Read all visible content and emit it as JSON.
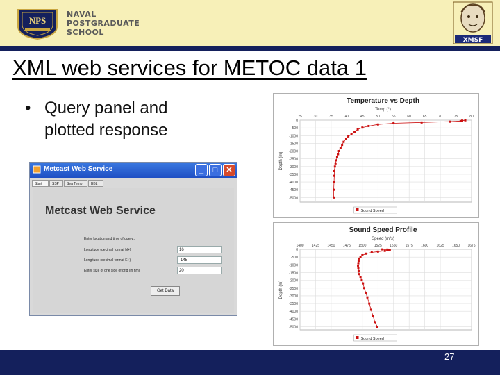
{
  "header": {
    "logo_text": "NPS",
    "school_lines": [
      "NAVAL",
      "POSTGRADUATE",
      "SCHOOL"
    ],
    "xmsf_logo_text": "XMSF"
  },
  "title": "XML web services for METOC data 1",
  "bullet": "Query panel and plotted response",
  "app": {
    "window_title": "Metcast Web Service",
    "tabs": [
      "Start",
      "SSP",
      "Sea Temp",
      "BBL"
    ],
    "heading": "Metcast Web Service",
    "form_intro": "Enter location and time of query...",
    "fields": [
      {
        "label": "Longitude (decimal format N+)",
        "value": "16"
      },
      {
        "label": "Longitude (decimal format E+)",
        "value": "-145"
      },
      {
        "label": "Enter size of one side of grid (in nm)",
        "value": "20"
      }
    ],
    "button": "Get Data"
  },
  "chart_data": [
    {
      "type": "line",
      "title": "Temperature vs Depth",
      "xlabel": "Temp (°)",
      "ylabel": "Depth (m)",
      "x_ticks": [
        "25",
        "30",
        "35",
        "40",
        "45",
        "50",
        "55",
        "60",
        "65",
        "70",
        "75",
        "80"
      ],
      "y_ticks": [
        "0",
        "-500",
        "-1000",
        "-1500",
        "-2000",
        "-2500",
        "-3000",
        "-3500",
        "-4000",
        "-4500",
        "-5000"
      ],
      "xlim": [
        25,
        80
      ],
      "ylim": [
        -5300,
        0
      ],
      "grid": true,
      "legend": "bottom",
      "series": [
        {
          "name": "Sound Speed",
          "color": "#cc1111",
          "points": [
            [
              78,
              -10
            ],
            [
              77,
              -30
            ],
            [
              76.5,
              -60
            ],
            [
              73,
              -100
            ],
            [
              64,
              -150
            ],
            [
              55,
              -200
            ],
            [
              50,
              -280
            ],
            [
              47,
              -380
            ],
            [
              45,
              -480
            ],
            [
              43.5,
              -600
            ],
            [
              42.5,
              -750
            ],
            [
              41.5,
              -900
            ],
            [
              40.5,
              -1050
            ],
            [
              39.8,
              -1200
            ],
            [
              39,
              -1400
            ],
            [
              38.5,
              -1600
            ],
            [
              38,
              -1800
            ],
            [
              37.5,
              -2000
            ],
            [
              37.2,
              -2200
            ],
            [
              36.9,
              -2400
            ],
            [
              36.6,
              -2600
            ],
            [
              36.4,
              -2800
            ],
            [
              36.2,
              -3000
            ],
            [
              36,
              -3300
            ],
            [
              36,
              -3600
            ],
            [
              35.9,
              -4000
            ],
            [
              35.8,
              -4500
            ],
            [
              35.8,
              -5000
            ]
          ]
        }
      ]
    },
    {
      "type": "line",
      "title": "Sound Speed Profile",
      "xlabel": "Speed (m/s)",
      "ylabel": "Depth (m)",
      "x_ticks": [
        "1400",
        "1425",
        "1450",
        "1475",
        "1500",
        "1525",
        "1550",
        "1575",
        "1600",
        "1625",
        "1650",
        "1675"
      ],
      "y_ticks": [
        "0",
        "-500",
        "-1000",
        "-1500",
        "-2000",
        "-2500",
        "-3000",
        "-3500",
        "-4000",
        "-4500",
        "-5000"
      ],
      "xlim": [
        1400,
        1675
      ],
      "ylim": [
        -5200,
        0
      ],
      "grid": true,
      "legend": "bottom",
      "series": [
        {
          "name": "Sound Speed",
          "color": "#cc1111",
          "points": [
            [
              1532,
              -5
            ],
            [
              1540,
              -15
            ],
            [
              1544,
              -30
            ],
            [
              1542,
              -60
            ],
            [
              1536,
              -100
            ],
            [
              1525,
              -150
            ],
            [
              1515,
              -200
            ],
            [
              1506,
              -280
            ],
            [
              1500,
              -380
            ],
            [
              1497,
              -480
            ],
            [
              1495,
              -600
            ],
            [
              1494,
              -750
            ],
            [
              1493.5,
              -900
            ],
            [
              1493,
              -1050
            ],
            [
              1493.5,
              -1200
            ],
            [
              1494,
              -1400
            ],
            [
              1495,
              -1600
            ],
            [
              1497,
              -1800
            ],
            [
              1499,
              -2000
            ],
            [
              1501,
              -2200
            ],
            [
              1503,
              -2500
            ],
            [
              1505.5,
              -2800
            ],
            [
              1508,
              -3100
            ],
            [
              1511,
              -3500
            ],
            [
              1514,
              -3900
            ],
            [
              1517,
              -4300
            ],
            [
              1520,
              -4700
            ],
            [
              1524,
              -5000
            ]
          ]
        }
      ]
    }
  ],
  "footer": {
    "page_number": "27"
  }
}
